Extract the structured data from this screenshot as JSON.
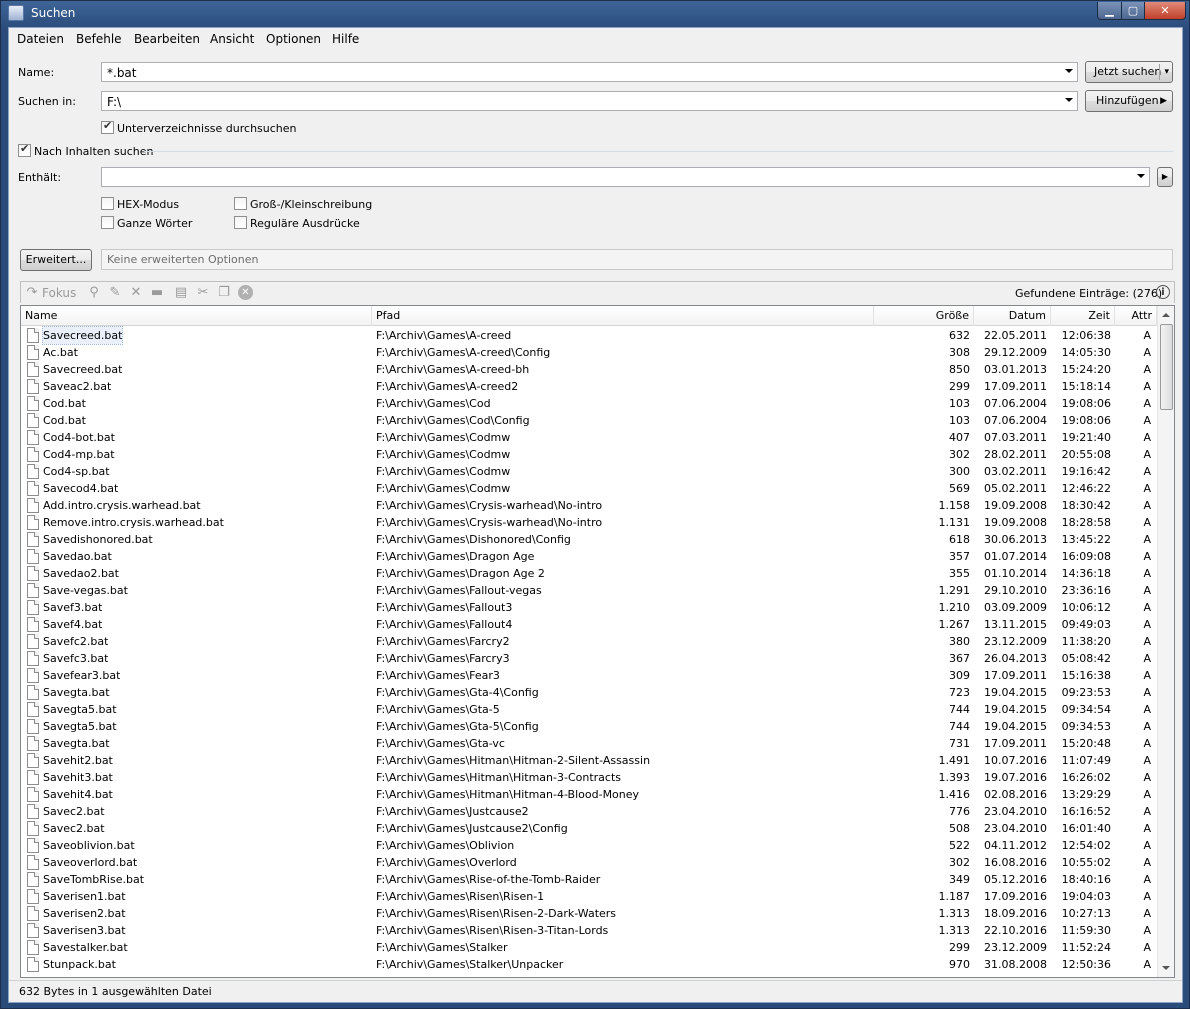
{
  "window": {
    "title": "Suchen"
  },
  "menu": [
    "Dateien",
    "Befehle",
    "Bearbeiten",
    "Ansicht",
    "Optionen",
    "Hilfe"
  ],
  "search": {
    "name_label": "Name:",
    "name_value": "*.bat",
    "search_in_label": "Suchen in:",
    "search_in_value": "F:\\",
    "search_button": "Jetzt suchen",
    "add_button": "Hinzufügen",
    "subdirs_label": "Unterverzeichnisse durchsuchen",
    "subdirs_checked": true,
    "content_search_label": "Nach Inhalten suchen",
    "content_search_checked": true,
    "contains_label": "Enthält:",
    "contains_value": "",
    "hex_label": "HEX-Modus",
    "words_label": "Ganze Wörter",
    "case_label": "Groß-/Kleinschreibung",
    "regex_label": "Reguläre Ausdrücke",
    "advanced_button": "Erweitert...",
    "advanced_text": "Keine erweiterten Optionen"
  },
  "toolbar": {
    "focus_label": "Fokus",
    "found_label": "Gefundene Einträge: (276)"
  },
  "columns": {
    "name": "Name",
    "path": "Pfad",
    "size": "Größe",
    "date": "Datum",
    "time": "Zeit",
    "attr": "Attr"
  },
  "rows": [
    [
      "Savecreed.bat",
      "F:\\Archiv\\Games\\A-creed",
      "632",
      "22.05.2011",
      "12:06:38",
      "A"
    ],
    [
      "Ac.bat",
      "F:\\Archiv\\Games\\A-creed\\Config",
      "308",
      "29.12.2009",
      "14:05:30",
      "A"
    ],
    [
      "Savecreed.bat",
      "F:\\Archiv\\Games\\A-creed-bh",
      "850",
      "03.01.2013",
      "15:24:20",
      "A"
    ],
    [
      "Saveac2.bat",
      "F:\\Archiv\\Games\\A-creed2",
      "299",
      "17.09.2011",
      "15:18:14",
      "A"
    ],
    [
      "Cod.bat",
      "F:\\Archiv\\Games\\Cod",
      "103",
      "07.06.2004",
      "19:08:06",
      "A"
    ],
    [
      "Cod.bat",
      "F:\\Archiv\\Games\\Cod\\Config",
      "103",
      "07.06.2004",
      "19:08:06",
      "A"
    ],
    [
      "Cod4-bot.bat",
      "F:\\Archiv\\Games\\Codmw",
      "407",
      "07.03.2011",
      "19:21:40",
      "A"
    ],
    [
      "Cod4-mp.bat",
      "F:\\Archiv\\Games\\Codmw",
      "302",
      "28.02.2011",
      "20:55:08",
      "A"
    ],
    [
      "Cod4-sp.bat",
      "F:\\Archiv\\Games\\Codmw",
      "300",
      "03.02.2011",
      "19:16:42",
      "A"
    ],
    [
      "Savecod4.bat",
      "F:\\Archiv\\Games\\Codmw",
      "569",
      "05.02.2011",
      "12:46:22",
      "A"
    ],
    [
      "Add.intro.crysis.warhead.bat",
      "F:\\Archiv\\Games\\Crysis-warhead\\No-intro",
      "1.158",
      "19.09.2008",
      "18:30:42",
      "A"
    ],
    [
      "Remove.intro.crysis.warhead.bat",
      "F:\\Archiv\\Games\\Crysis-warhead\\No-intro",
      "1.131",
      "19.09.2008",
      "18:28:58",
      "A"
    ],
    [
      "Savedishonored.bat",
      "F:\\Archiv\\Games\\Dishonored\\Config",
      "618",
      "30.06.2013",
      "13:45:22",
      "A"
    ],
    [
      "Savedao.bat",
      "F:\\Archiv\\Games\\Dragon Age",
      "357",
      "01.07.2014",
      "16:09:08",
      "A"
    ],
    [
      "Savedao2.bat",
      "F:\\Archiv\\Games\\Dragon Age 2",
      "355",
      "01.10.2014",
      "14:36:18",
      "A"
    ],
    [
      "Save-vegas.bat",
      "F:\\Archiv\\Games\\Fallout-vegas",
      "1.291",
      "29.10.2010",
      "23:36:16",
      "A"
    ],
    [
      "Savef3.bat",
      "F:\\Archiv\\Games\\Fallout3",
      "1.210",
      "03.09.2009",
      "10:06:12",
      "A"
    ],
    [
      "Savef4.bat",
      "F:\\Archiv\\Games\\Fallout4",
      "1.267",
      "13.11.2015",
      "09:49:03",
      "A"
    ],
    [
      "Savefc2.bat",
      "F:\\Archiv\\Games\\Farcry2",
      "380",
      "23.12.2009",
      "11:38:20",
      "A"
    ],
    [
      "Savefc3.bat",
      "F:\\Archiv\\Games\\Farcry3",
      "367",
      "26.04.2013",
      "05:08:42",
      "A"
    ],
    [
      "Savefear3.bat",
      "F:\\Archiv\\Games\\Fear3",
      "309",
      "17.09.2011",
      "15:16:38",
      "A"
    ],
    [
      "Savegta.bat",
      "F:\\Archiv\\Games\\Gta-4\\Config",
      "723",
      "19.04.2015",
      "09:23:53",
      "A"
    ],
    [
      "Savegta5.bat",
      "F:\\Archiv\\Games\\Gta-5",
      "744",
      "19.04.2015",
      "09:34:54",
      "A"
    ],
    [
      "Savegta5.bat",
      "F:\\Archiv\\Games\\Gta-5\\Config",
      "744",
      "19.04.2015",
      "09:34:53",
      "A"
    ],
    [
      "Savegta.bat",
      "F:\\Archiv\\Games\\Gta-vc",
      "731",
      "17.09.2011",
      "15:20:48",
      "A"
    ],
    [
      "Savehit2.bat",
      "F:\\Archiv\\Games\\Hitman\\Hitman-2-Silent-Assassin",
      "1.491",
      "10.07.2016",
      "11:07:49",
      "A"
    ],
    [
      "Savehit3.bat",
      "F:\\Archiv\\Games\\Hitman\\Hitman-3-Contracts",
      "1.393",
      "19.07.2016",
      "16:26:02",
      "A"
    ],
    [
      "Savehit4.bat",
      "F:\\Archiv\\Games\\Hitman\\Hitman-4-Blood-Money",
      "1.416",
      "02.08.2016",
      "13:29:29",
      "A"
    ],
    [
      "Savec2.bat",
      "F:\\Archiv\\Games\\Justcause2",
      "776",
      "23.04.2010",
      "16:16:52",
      "A"
    ],
    [
      "Savec2.bat",
      "F:\\Archiv\\Games\\Justcause2\\Config",
      "508",
      "23.04.2010",
      "16:01:40",
      "A"
    ],
    [
      "Saveoblivion.bat",
      "F:\\Archiv\\Games\\Oblivion",
      "522",
      "04.11.2012",
      "12:54:02",
      "A"
    ],
    [
      "Saveoverlord.bat",
      "F:\\Archiv\\Games\\Overlord",
      "302",
      "16.08.2016",
      "10:55:02",
      "A"
    ],
    [
      "SaveTombRise.bat",
      "F:\\Archiv\\Games\\Rise-of-the-Tomb-Raider",
      "349",
      "05.12.2016",
      "18:40:16",
      "A"
    ],
    [
      "Saverisen1.bat",
      "F:\\Archiv\\Games\\Risen\\Risen-1",
      "1.187",
      "17.09.2016",
      "19:04:03",
      "A"
    ],
    [
      "Saverisen2.bat",
      "F:\\Archiv\\Games\\Risen\\Risen-2-Dark-Waters",
      "1.313",
      "18.09.2016",
      "10:27:13",
      "A"
    ],
    [
      "Saverisen3.bat",
      "F:\\Archiv\\Games\\Risen\\Risen-3-Titan-Lords",
      "1.313",
      "22.10.2016",
      "11:59:30",
      "A"
    ],
    [
      "Savestalker.bat",
      "F:\\Archiv\\Games\\Stalker",
      "299",
      "23.12.2009",
      "11:52:24",
      "A"
    ],
    [
      "Stunpack.bat",
      "F:\\Archiv\\Games\\Stalker\\Unpacker",
      "970",
      "31.08.2008",
      "12:50:36",
      "A"
    ]
  ],
  "status": "632 Bytes in 1 ausgewählten Datei"
}
